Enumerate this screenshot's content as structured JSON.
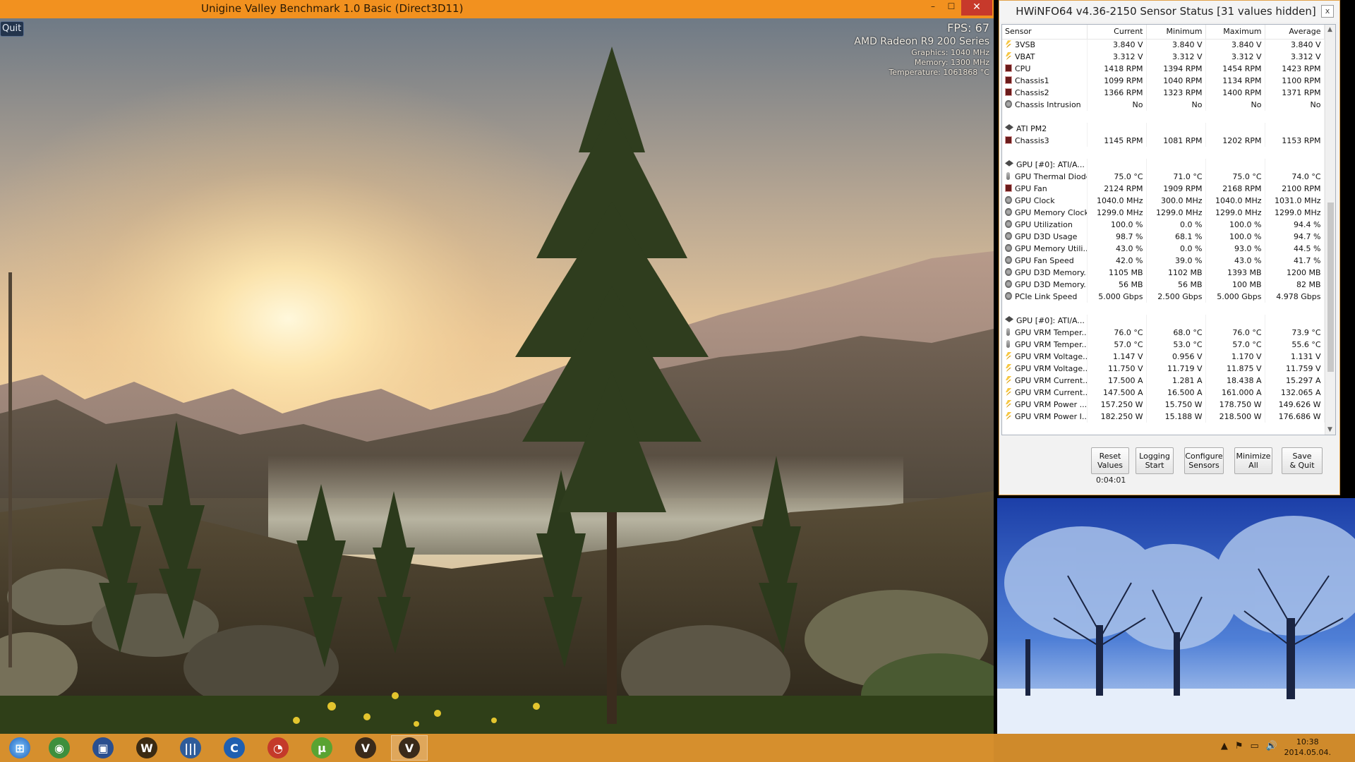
{
  "valley": {
    "title": "Unigine Valley Benchmark 1.0 Basic (Direct3D11)",
    "controls": {
      "minimize": "–",
      "maximize": "☐",
      "close": "✕"
    },
    "quit_label": "Quit",
    "hud": {
      "fps": "FPS: 67",
      "gpu": "AMD Radeon R9 200 Series",
      "graphics": "Graphics: 1040 MHz",
      "memory": "Memory: 1300 MHz",
      "temperature": "Temperature: 1061868 °C"
    }
  },
  "hwinfo": {
    "title": "HWiNFO64 v4.36-2150 Sensor Status [31 values hidden]",
    "close": "x",
    "columns": [
      "Sensor",
      "Current",
      "Minimum",
      "Maximum",
      "Average"
    ],
    "rows": [
      {
        "icon": "volt",
        "name": "3VSB",
        "cur": "3.840 V",
        "min": "3.840 V",
        "max": "3.840 V",
        "avg": "3.840 V"
      },
      {
        "icon": "volt",
        "name": "VBAT",
        "cur": "3.312 V",
        "min": "3.312 V",
        "max": "3.312 V",
        "avg": "3.312 V"
      },
      {
        "icon": "fan",
        "name": "CPU",
        "cur": "1418 RPM",
        "min": "1394 RPM",
        "max": "1454 RPM",
        "avg": "1423 RPM"
      },
      {
        "icon": "fan",
        "name": "Chassis1",
        "cur": "1099 RPM",
        "min": "1040 RPM",
        "max": "1134 RPM",
        "avg": "1100 RPM"
      },
      {
        "icon": "fan",
        "name": "Chassis2",
        "cur": "1366 RPM",
        "min": "1323 RPM",
        "max": "1400 RPM",
        "avg": "1371 RPM"
      },
      {
        "icon": "gen",
        "name": "Chassis Intrusion",
        "cur": "No",
        "min": "No",
        "max": "No",
        "avg": "No"
      },
      {
        "spacer": true
      },
      {
        "icon": "dev",
        "name": "ATI PM2",
        "cur": "",
        "min": "",
        "max": "",
        "avg": ""
      },
      {
        "icon": "fan",
        "name": "Chassis3",
        "cur": "1145 RPM",
        "min": "1081 RPM",
        "max": "1202 RPM",
        "avg": "1153 RPM"
      },
      {
        "spacer": true
      },
      {
        "icon": "dev",
        "name": "GPU [#0]: ATI/A...",
        "cur": "",
        "min": "",
        "max": "",
        "avg": ""
      },
      {
        "icon": "temp",
        "name": "GPU Thermal Diode",
        "cur": "75.0 °C",
        "min": "71.0 °C",
        "max": "75.0 °C",
        "avg": "74.0 °C"
      },
      {
        "icon": "fan",
        "name": "GPU Fan",
        "cur": "2124 RPM",
        "min": "1909 RPM",
        "max": "2168 RPM",
        "avg": "2100 RPM"
      },
      {
        "icon": "gen",
        "name": "GPU Clock",
        "cur": "1040.0 MHz",
        "min": "300.0 MHz",
        "max": "1040.0 MHz",
        "avg": "1031.0 MHz"
      },
      {
        "icon": "gen",
        "name": "GPU Memory Clock",
        "cur": "1299.0 MHz",
        "min": "1299.0 MHz",
        "max": "1299.0 MHz",
        "avg": "1299.0 MHz"
      },
      {
        "icon": "gen",
        "name": "GPU Utilization",
        "cur": "100.0 %",
        "min": "0.0 %",
        "max": "100.0 %",
        "avg": "94.4 %"
      },
      {
        "icon": "gen",
        "name": "GPU D3D Usage",
        "cur": "98.7 %",
        "min": "68.1 %",
        "max": "100.0 %",
        "avg": "94.7 %"
      },
      {
        "icon": "gen",
        "name": "GPU Memory Utili...",
        "cur": "43.0 %",
        "min": "0.0 %",
        "max": "93.0 %",
        "avg": "44.5 %"
      },
      {
        "icon": "gen",
        "name": "GPU Fan Speed",
        "cur": "42.0 %",
        "min": "39.0 %",
        "max": "43.0 %",
        "avg": "41.7 %"
      },
      {
        "icon": "gen",
        "name": "GPU D3D Memory...",
        "cur": "1105 MB",
        "min": "1102 MB",
        "max": "1393 MB",
        "avg": "1200 MB"
      },
      {
        "icon": "gen",
        "name": "GPU D3D Memory...",
        "cur": "56 MB",
        "min": "56 MB",
        "max": "100 MB",
        "avg": "82 MB"
      },
      {
        "icon": "gen",
        "name": "PCIe Link Speed",
        "cur": "5.000 Gbps",
        "min": "2.500 Gbps",
        "max": "5.000 Gbps",
        "avg": "4.978 Gbps"
      },
      {
        "spacer": true
      },
      {
        "icon": "dev",
        "name": "GPU [#0]: ATI/A...",
        "cur": "",
        "min": "",
        "max": "",
        "avg": ""
      },
      {
        "icon": "temp",
        "name": "GPU VRM Temper...",
        "cur": "76.0 °C",
        "min": "68.0 °C",
        "max": "76.0 °C",
        "avg": "73.9 °C"
      },
      {
        "icon": "temp",
        "name": "GPU VRM Temper...",
        "cur": "57.0 °C",
        "min": "53.0 °C",
        "max": "57.0 °C",
        "avg": "55.6 °C"
      },
      {
        "icon": "volt",
        "name": "GPU VRM Voltage...",
        "cur": "1.147 V",
        "min": "0.956 V",
        "max": "1.170 V",
        "avg": "1.131 V"
      },
      {
        "icon": "volt",
        "name": "GPU VRM Voltage...",
        "cur": "11.750 V",
        "min": "11.719 V",
        "max": "11.875 V",
        "avg": "11.759 V"
      },
      {
        "icon": "volt",
        "name": "GPU VRM Current...",
        "cur": "17.500 A",
        "min": "1.281 A",
        "max": "18.438 A",
        "avg": "15.297 A"
      },
      {
        "icon": "volt",
        "name": "GPU VRM Current...",
        "cur": "147.500 A",
        "min": "16.500 A",
        "max": "161.000 A",
        "avg": "132.065 A"
      },
      {
        "icon": "volt",
        "name": "GPU VRM Power ...",
        "cur": "157.250 W",
        "min": "15.750 W",
        "max": "178.750 W",
        "avg": "149.626 W"
      },
      {
        "icon": "volt",
        "name": "GPU VRM Power I...",
        "cur": "182.250 W",
        "min": "15.188 W",
        "max": "218.500 W",
        "avg": "176.686 W"
      }
    ],
    "buttons": [
      {
        "id": "reset-values-button",
        "line1": "Reset",
        "line2": "Values"
      },
      {
        "id": "logging-start-button",
        "line1": "Logging",
        "line2": "Start"
      },
      {
        "id": "configure-sensors-button",
        "line1": "Configure",
        "line2": "Sensors"
      },
      {
        "id": "minimize-all-button",
        "line1": "Minimize",
        "line2": "All"
      },
      {
        "id": "save-quit-button",
        "line1": "Save",
        "line2": "& Quit"
      }
    ],
    "timer": "0:04:01"
  },
  "taskbar": {
    "start_icon": "windows-start-icon",
    "apps": [
      {
        "name": "chrome-icon",
        "glyph": "◉",
        "color": "#3d8f3d"
      },
      {
        "name": "save-floppy-icon",
        "glyph": "▣",
        "color": "#2a4f8f"
      },
      {
        "name": "wow-icon",
        "glyph": "W",
        "color": "#3b2a12"
      },
      {
        "name": "hwinfo-app-icon",
        "glyph": "|||",
        "color": "#2e5c9a"
      },
      {
        "name": "ccleaner-icon",
        "glyph": "C",
        "color": "#1f5fb0"
      },
      {
        "name": "speed-dial-icon",
        "glyph": "◔",
        "color": "#c43a2a"
      },
      {
        "name": "utorrent-icon",
        "glyph": "µ",
        "color": "#5aa332"
      },
      {
        "name": "valley-app-icon",
        "glyph": "V",
        "color": "#3a2a1a"
      },
      {
        "name": "valley-app-active-icon",
        "glyph": "V",
        "color": "#3a2a1a"
      }
    ],
    "tray": [
      "▲",
      "⚑",
      "▭",
      "🔊"
    ],
    "clock_time": "10:38",
    "clock_date": "2014.05.04."
  }
}
